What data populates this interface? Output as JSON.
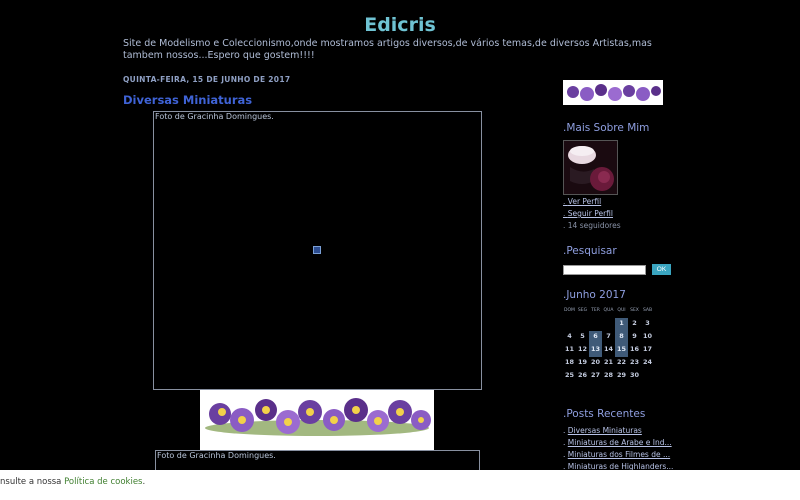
{
  "header": {
    "title": "Edicris",
    "description": "Site de Modelismo e Coleccionismo,onde mostramos artigos diversos,de vários temas,de diversos Artistas,mas tambem nossos...Espero que gostem!!!!"
  },
  "post": {
    "date": "QUINTA-FEIRA, 15 DE JUNHO DE 2017",
    "title": "Diversas Miniaturas",
    "caption1": "Foto de Gracinha Domingues.",
    "caption2": "Foto de Gracinha Domingues."
  },
  "sidebar": {
    "about_title": ".Mais Sobre Mim",
    "profile_links": [
      {
        "dot": ". ",
        "label": "Ver Perfil"
      },
      {
        "dot": ". ",
        "label": "Seguir Perfil"
      }
    ],
    "followers": ". 14 seguidores",
    "search_title": ".Pesquisar",
    "search_button": "OK",
    "calendar_title": ".Junho 2017",
    "calendar_days": [
      "DOM",
      "SEG",
      "TER",
      "QUA",
      "QUI",
      "SEX",
      "SAB"
    ],
    "calendar_weeks": [
      [
        "",
        "",
        "",
        "",
        "1",
        "2",
        "3"
      ],
      [
        "4",
        "5",
        "6",
        "7",
        "8",
        "9",
        "10"
      ],
      [
        "11",
        "12",
        "13",
        "14",
        "15",
        "16",
        "17"
      ],
      [
        "18",
        "19",
        "20",
        "21",
        "22",
        "23",
        "24"
      ],
      [
        "25",
        "26",
        "27",
        "28",
        "29",
        "30",
        ""
      ]
    ],
    "calendar_linked_days": [
      "1",
      "6",
      "8",
      "13",
      "15"
    ],
    "recent_title": ".Posts Recentes",
    "recent_posts": [
      {
        "dot": ". ",
        "label": "Diversas Miniaturas"
      },
      {
        "dot": ". ",
        "label": "Miniaturas de Arabe e Ind..."
      },
      {
        "dot": ". ",
        "label": "Miniaturas dos Filmes de ..."
      },
      {
        "dot": ". ",
        "label": "Miniaturas de Highlanders..."
      }
    ]
  },
  "cookie": {
    "text": "nsulte a nossa ",
    "link": "Política de cookies",
    "end": "."
  },
  "colors": {
    "title": "#6fc3d3",
    "post_title": "#3f63d6",
    "background": "#000000"
  }
}
